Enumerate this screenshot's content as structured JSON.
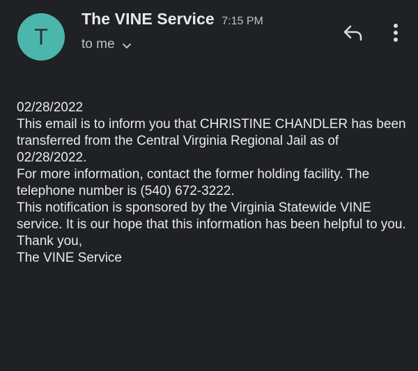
{
  "header": {
    "avatar_letter": "T",
    "sender_name": "The VINE Service",
    "time": "7:15 PM",
    "recipient": "to me",
    "icons": {
      "reply": "reply-icon",
      "more": "more-vert-icon",
      "chevron": "chevron-down-icon"
    },
    "colors": {
      "background": "#202124",
      "avatar_bg": "#4db6ac",
      "text_primary": "#e8eaed",
      "text_secondary": "#bdc1c6"
    }
  },
  "message": {
    "date": "02/28/2022",
    "paragraph_1": "This email is to inform you that CHRISTINE CHANDLER has been transferred from the Central Virginia Regional Jail as of 02/28/2022.",
    "paragraph_2": "For more information, contact the former holding facility. The telephone number is (540) 672-3222.",
    "paragraph_3": "This notification is sponsored by the Virginia Statewide VINE service. It is our hope that this information has been helpful to you.",
    "closing": "Thank you,",
    "signature": "The VINE Service"
  }
}
